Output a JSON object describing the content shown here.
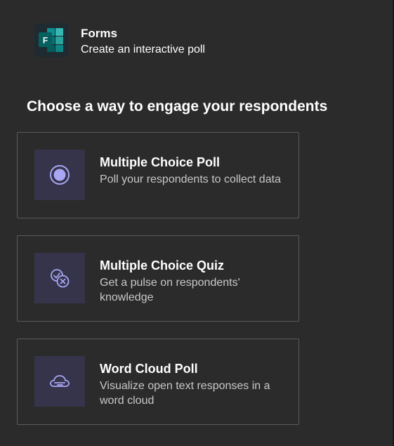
{
  "app": {
    "name": "Forms",
    "subtitle": "Create an interactive poll",
    "logo_letter": "F"
  },
  "heading": "Choose a way to engage your respondents",
  "options": [
    {
      "title": "Multiple Choice Poll",
      "description": "Poll your respondents to collect data",
      "icon": "radio-button-icon"
    },
    {
      "title": "Multiple Choice Quiz",
      "description": "Get a pulse on respondents' knowledge",
      "icon": "check-cross-icon"
    },
    {
      "title": "Word Cloud Poll",
      "description": "Visualize open text responses in a word cloud",
      "icon": "word-cloud-icon"
    }
  ],
  "colors": {
    "background": "#2b2b2b",
    "card_border": "#5a5a5a",
    "icon_tile": "#35344a",
    "icon_accent": "#a9a6f6",
    "forms_teal": "#037c7c"
  }
}
